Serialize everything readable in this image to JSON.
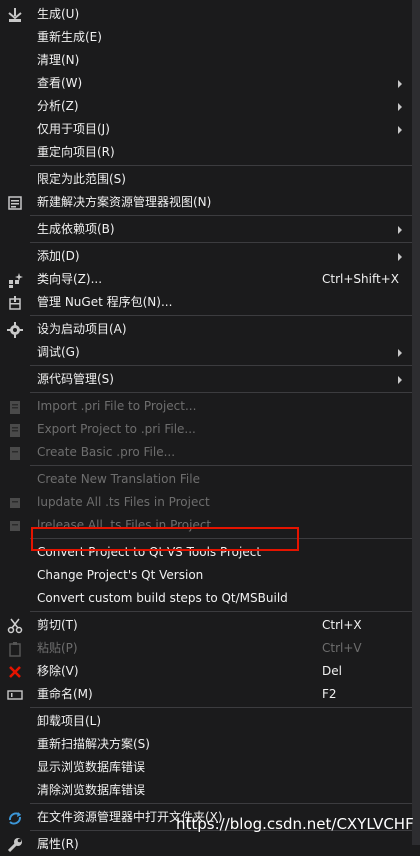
{
  "groups": [
    [
      {
        "icon": "build-icon",
        "label": "生成(U)"
      },
      {
        "label": "重新生成(E)"
      },
      {
        "label": "清理(N)"
      },
      {
        "label": "查看(W)",
        "submenu": true
      },
      {
        "label": "分析(Z)",
        "submenu": true
      },
      {
        "label": "仅用于项目(J)",
        "submenu": true
      },
      {
        "label": "重定向项目(R)"
      }
    ],
    [
      {
        "label": "限定为此范围(S)"
      },
      {
        "icon": "new-solution-view-icon",
        "label": "新建解决方案资源管理器视图(N)"
      }
    ],
    [
      {
        "label": "生成依赖项(B)",
        "submenu": true
      }
    ],
    [
      {
        "label": "添加(D)",
        "submenu": true
      },
      {
        "icon": "class-wizard-icon",
        "label": "类向导(Z)...",
        "shortcut": "Ctrl+Shift+X"
      },
      {
        "icon": "nuget-package-icon",
        "label": "管理 NuGet 程序包(N)..."
      }
    ],
    [
      {
        "icon": "gear-icon",
        "label": "设为启动项目(A)"
      },
      {
        "label": "调试(G)",
        "submenu": true
      }
    ],
    [
      {
        "label": "源代码管理(S)",
        "submenu": true
      }
    ],
    [
      {
        "icon": "import-pri-icon",
        "label": "Import .pri File to Project...",
        "disabled": true
      },
      {
        "icon": "export-pri-icon",
        "label": "Export Project to .pri File...",
        "disabled": true
      },
      {
        "icon": "create-pro-icon",
        "label": "Create Basic .pro File...",
        "disabled": true
      }
    ],
    [
      {
        "label": "Create New Translation File",
        "disabled": true
      },
      {
        "icon": "lupdate-icon",
        "label": "lupdate All .ts Files in Project",
        "disabled": true
      },
      {
        "icon": "lrelease-icon",
        "label": "lrelease All .ts Files in Project",
        "disabled": true
      }
    ],
    [
      {
        "label": "Convert Project to Qt VS Tools Project",
        "highlighted": true
      },
      {
        "label": "Change Project's Qt Version"
      },
      {
        "label": "Convert custom build steps to Qt/MSBuild"
      }
    ],
    [
      {
        "icon": "scissors-icon",
        "label": "剪切(T)",
        "shortcut": "Ctrl+X"
      },
      {
        "icon": "paste-icon",
        "label": "粘贴(P)",
        "shortcut": "Ctrl+V",
        "disabled": true
      },
      {
        "icon": "delete-icon",
        "label": "移除(V)",
        "shortcut": "Del"
      },
      {
        "icon": "rename-icon",
        "label": "重命名(M)",
        "shortcut": "F2"
      }
    ],
    [
      {
        "label": "卸载项目(L)"
      },
      {
        "label": "重新扫描解决方案(S)"
      },
      {
        "label": "显示浏览数据库错误"
      },
      {
        "label": "清除浏览数据库错误"
      }
    ],
    [
      {
        "icon": "refresh-folder-icon",
        "label": "在文件资源管理器中打开文件夹(X)"
      }
    ],
    [
      {
        "icon": "wrench-icon",
        "label": "属性(R)"
      }
    ]
  ],
  "watermark": "https://blog.csdn.net/CXYLVCHF",
  "colors": {
    "highlight_border": "#e51400",
    "menu_bg": "#1b1b1c",
    "text": "#f1f1f1",
    "disabled_text": "#6e6e6e"
  }
}
